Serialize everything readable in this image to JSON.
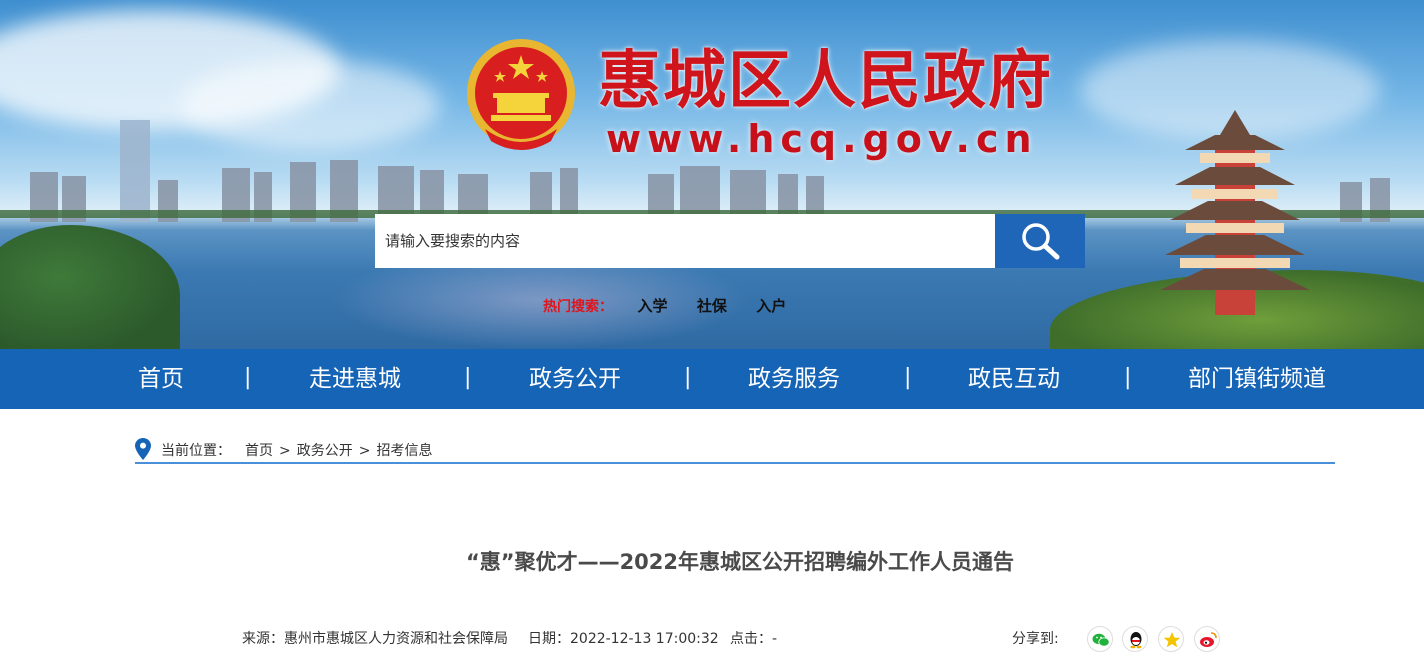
{
  "header": {
    "site_title": "惠城区人民政府",
    "site_url": "www.hcq.gov.cn",
    "search_placeholder": "请输入要搜索的内容",
    "hot_label": "热门搜索：",
    "hot_items": [
      "入学",
      "社保",
      "入户"
    ]
  },
  "nav": {
    "items": [
      "首页",
      "走进惠城",
      "政务公开",
      "政务服务",
      "政民互动",
      "部门镇街频道"
    ],
    "separator": "|"
  },
  "breadcrumb": {
    "label": "当前位置：",
    "path": [
      "首页",
      "政务公开",
      "招考信息"
    ],
    "sep": ">"
  },
  "article": {
    "title": "“惠”聚优才——2022年惠城区公开招聘编外工作人员通告",
    "source": "来源：惠州市惠城区人力资源和社会保障局",
    "date": "日期：2022-12-13 17:00:32",
    "clicks": "点击：-",
    "share_label": "分享到:"
  },
  "icons": [
    "search-icon",
    "location-pin-icon",
    "wechat-icon",
    "qq-icon",
    "qzone-icon",
    "weibo-icon",
    "national-emblem-icon"
  ],
  "colors": {
    "nav_bg": "#1664b6",
    "title_red": "#d0141b",
    "hot_red": "#e0141b"
  }
}
